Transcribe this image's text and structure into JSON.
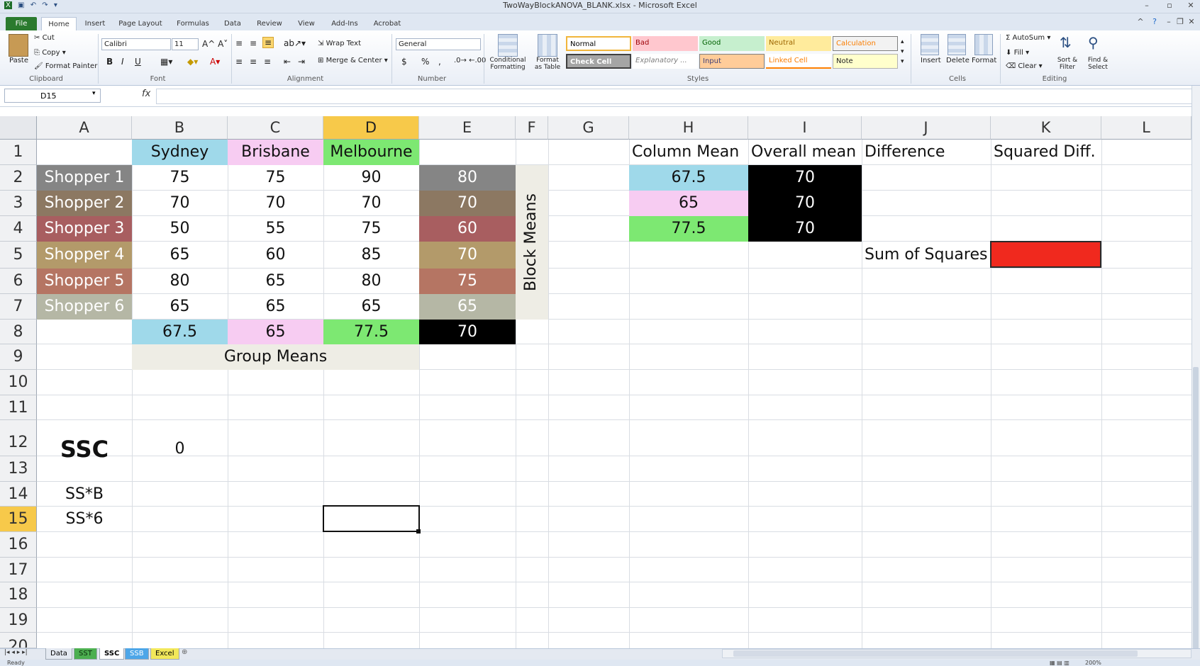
{
  "window": {
    "title": "TwoWayBlockANOVA_BLANK.xlsx - Microsoft Excel"
  },
  "ribbon_tabs": [
    "File",
    "Home",
    "Insert",
    "Page Layout",
    "Formulas",
    "Data",
    "Review",
    "View",
    "Add-Ins",
    "Acrobat"
  ],
  "clipboard": {
    "paste": "Paste",
    "cut": "Cut",
    "copy": "Copy",
    "format_painter": "Format Painter",
    "group": "Clipboard"
  },
  "font": {
    "name": "Calibri",
    "size": "11",
    "group": "Font",
    "bold": "B",
    "italic": "I",
    "underline": "U"
  },
  "alignment": {
    "wrap_text": "Wrap Text",
    "merge_center": "Merge & Center",
    "group": "Alignment"
  },
  "number": {
    "format": "General",
    "currency": "$",
    "percent": "%",
    "comma": ",",
    "group": "Number"
  },
  "styles": {
    "conditional": "Conditional Formatting",
    "format_table": "Format as Table",
    "group": "Styles",
    "normal": "Normal",
    "bad": "Bad",
    "good": "Good",
    "neutral": "Neutral",
    "calculation": "Calculation",
    "check_cell": "Check Cell",
    "explanatory": "Explanatory ...",
    "input": "Input",
    "linked_cell": "Linked Cell",
    "note": "Note"
  },
  "cells_group": {
    "insert": "Insert",
    "delete": "Delete",
    "format": "Format",
    "group": "Cells"
  },
  "editing": {
    "autosum": "AutoSum",
    "fill": "Fill",
    "clear": "Clear",
    "sort_filter": "Sort & Filter",
    "find_select": "Find & Select",
    "group": "Editing"
  },
  "formula_bar": {
    "name_box": "D15",
    "fx": "fx",
    "content": ""
  },
  "columns": [
    "A",
    "B",
    "C",
    "D",
    "E",
    "F",
    "G",
    "H",
    "I",
    "J",
    "K",
    "L"
  ],
  "rows": [
    "1",
    "2",
    "3",
    "4",
    "5",
    "6",
    "7",
    "8",
    "9",
    "10",
    "11",
    "12",
    "13",
    "14",
    "15",
    "16",
    "17",
    "18",
    "19",
    "20"
  ],
  "sheet": {
    "headers": [
      "Sydney",
      "Brisbane",
      "Melbourne"
    ],
    "shoppers": [
      "Shopper 1",
      "Shopper 2",
      "Shopper 3",
      "Shopper 4",
      "Shopper 5",
      "Shopper 6"
    ],
    "values": [
      [
        "75",
        "75",
        "90",
        "80"
      ],
      [
        "70",
        "70",
        "70",
        "70"
      ],
      [
        "50",
        "55",
        "75",
        "60"
      ],
      [
        "65",
        "60",
        "85",
        "70"
      ],
      [
        "80",
        "65",
        "80",
        "75"
      ],
      [
        "65",
        "65",
        "65",
        "65"
      ]
    ],
    "means_row": [
      "67.5",
      "65",
      "77.5",
      "70"
    ],
    "group_means_label": "Group Means",
    "block_means_label": "Block Means",
    "ssc_label": "SSC",
    "ssc_value": "0",
    "ssb_label": "SS*B",
    "ss6_label": "SS*6",
    "summary_headers": [
      "Column Mean",
      "Overall mean",
      "Difference",
      "Squared Diff."
    ],
    "column_means": [
      "67.5",
      "65",
      "77.5"
    ],
    "overall_means": [
      "70",
      "70",
      "70"
    ],
    "sum_of_squares_label": "Sum of Squares"
  },
  "colors": {
    "sydney": "#9fd9ea",
    "brisbane": "#f7ccf2",
    "melbourne": "#7de872",
    "black": "#000000",
    "sum_red": "#f0291e",
    "shoppers": [
      "#858585",
      "#8c7862",
      "#a85e60",
      "#b39a6a",
      "#b57563",
      "#b5b7a5"
    ]
  },
  "sheet_tabs": [
    "Data",
    "SST",
    "SSC",
    "SSB",
    "Excel"
  ],
  "status": {
    "ready": "Ready",
    "zoom": "200%"
  }
}
